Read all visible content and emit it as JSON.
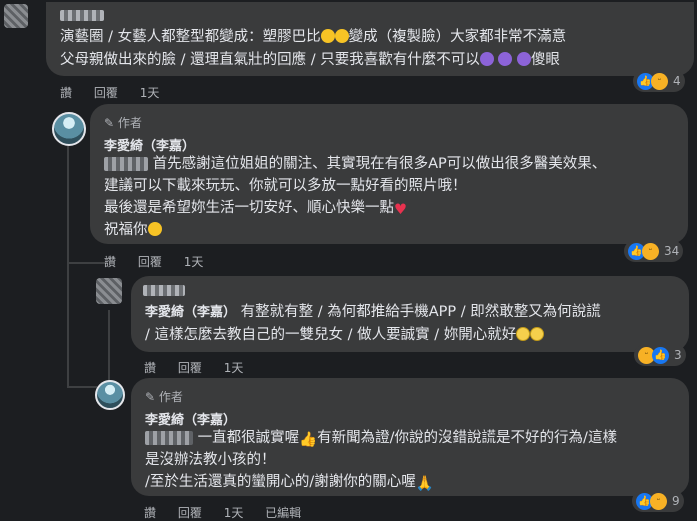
{
  "comment1": {
    "text_line1": "演藝圈 / 女藝人都整型都變成：塑膠巴比",
    "text_line1b": "變成（複製臉）大家都非常不滿意",
    "text_line2": "父母親做出來的臉 / 還理直氣壯的回應 / 只要我喜歡有什麼不可以",
    "text_line2b": "傻眼",
    "actions": {
      "like": "讚",
      "reply": "回覆",
      "time": "1天"
    },
    "reaction_count": "4"
  },
  "reply1": {
    "badge": "作者",
    "name": "李愛綺（李嘉）",
    "line1": "首先感謝這位姐姐的關注、其實現在有很多AP可以做出很多醫美效果、",
    "line2": "建議可以下載來玩玩、你就可以多放一點好看的照片哦！",
    "line3": "最後還是希望妳生活一切安好、順心快樂一點",
    "line4": "祝福你",
    "actions": {
      "like": "讚",
      "reply": "回覆",
      "time": "1天"
    },
    "reaction_count": "34"
  },
  "reply2": {
    "mention": "李愛綺（李嘉）",
    "line1": "有整就有整 / 為何都推給手機APP / 即然敢整又為何說謊",
    "line2": "/ 這樣怎麼去教自己的一雙兒女 / 做人要誠實 / 妳開心就好",
    "actions": {
      "like": "讚",
      "reply": "回覆",
      "time": "1天"
    },
    "reaction_count": "3"
  },
  "reply3": {
    "badge": "作者",
    "name": "李愛綺（李嘉）",
    "line1": "一直都很誠實喔",
    "line1b": "有新聞為證/你說的沒錯說謊是不好的行為/這樣",
    "line2": "是沒辦法教小孩的！",
    "line3": "/至於生活還真的蠻開心的/謝謝你的關心喔",
    "actions": {
      "like": "讚",
      "reply": "回覆",
      "time": "1天",
      "edited": "已編輯"
    },
    "reaction_count": "9"
  }
}
